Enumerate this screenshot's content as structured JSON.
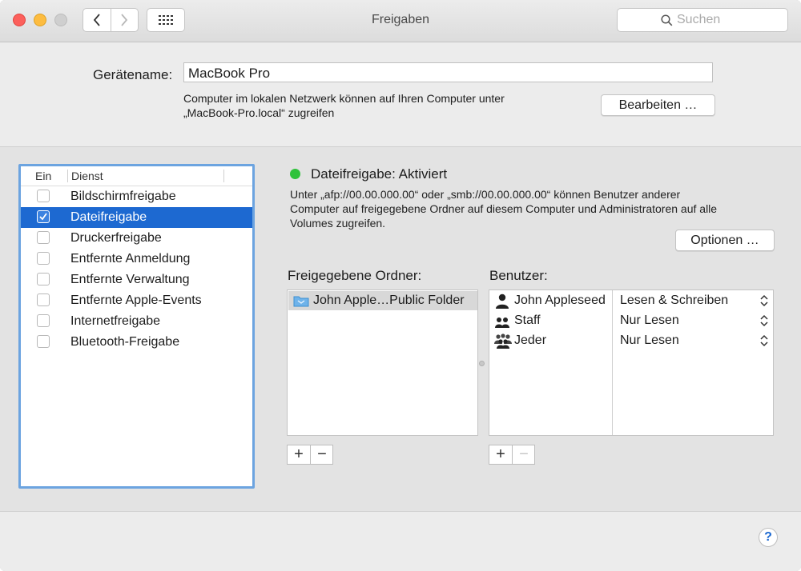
{
  "window": {
    "title": "Freigaben"
  },
  "search": {
    "placeholder": "Suchen"
  },
  "device": {
    "label": "Gerätename:",
    "value": "MacBook Pro",
    "note_line1": "Computer im lokalen Netzwerk können auf Ihren Computer unter",
    "note_line2": "„MacBook-Pro.local“ zugreifen",
    "edit_button": "Bearbeiten …"
  },
  "services": {
    "header_on": "Ein",
    "header_service": "Dienst",
    "items": [
      {
        "label": "Bildschirmfreigabe",
        "checked": false,
        "selected": false
      },
      {
        "label": "Dateifreigabe",
        "checked": true,
        "selected": true
      },
      {
        "label": "Druckerfreigabe",
        "checked": false,
        "selected": false
      },
      {
        "label": "Entfernte Anmeldung",
        "checked": false,
        "selected": false
      },
      {
        "label": "Entfernte Verwaltung",
        "checked": false,
        "selected": false
      },
      {
        "label": "Entfernte Apple-Events",
        "checked": false,
        "selected": false
      },
      {
        "label": "Internetfreigabe",
        "checked": false,
        "selected": false
      },
      {
        "label": "Bluetooth-Freigabe",
        "checked": false,
        "selected": false
      }
    ]
  },
  "status": {
    "title": "Dateifreigabe: Aktiviert",
    "color": "#2fc23b",
    "desc_line1": "Unter „afp://00.00.000.00“ oder „smb://00.00.000.00“ können Benutzer anderer",
    "desc_line2": "Computer auf freigegebene Ordner auf diesem Computer und Administratoren auf alle",
    "desc_line3": "Volumes zugreifen.",
    "options_button": "Optionen …"
  },
  "folders": {
    "label": "Freigegebene Ordner:",
    "items": [
      {
        "name": "John Apple…Public Folder"
      }
    ]
  },
  "users": {
    "label": "Benutzer:",
    "items": [
      {
        "name": "John Appleseed",
        "permission": "Lesen & Schreiben",
        "icon": "single-user-icon"
      },
      {
        "name": "Staff",
        "permission": "Nur Lesen",
        "icon": "group-icon"
      },
      {
        "name": "Jeder",
        "permission": "Nur Lesen",
        "icon": "everyone-icon"
      }
    ]
  },
  "controls": {
    "plus": "+",
    "minus": "−",
    "help": "?"
  },
  "colors": {
    "selection": "#1d69d1",
    "focus_ring": "#6ca4e0"
  }
}
